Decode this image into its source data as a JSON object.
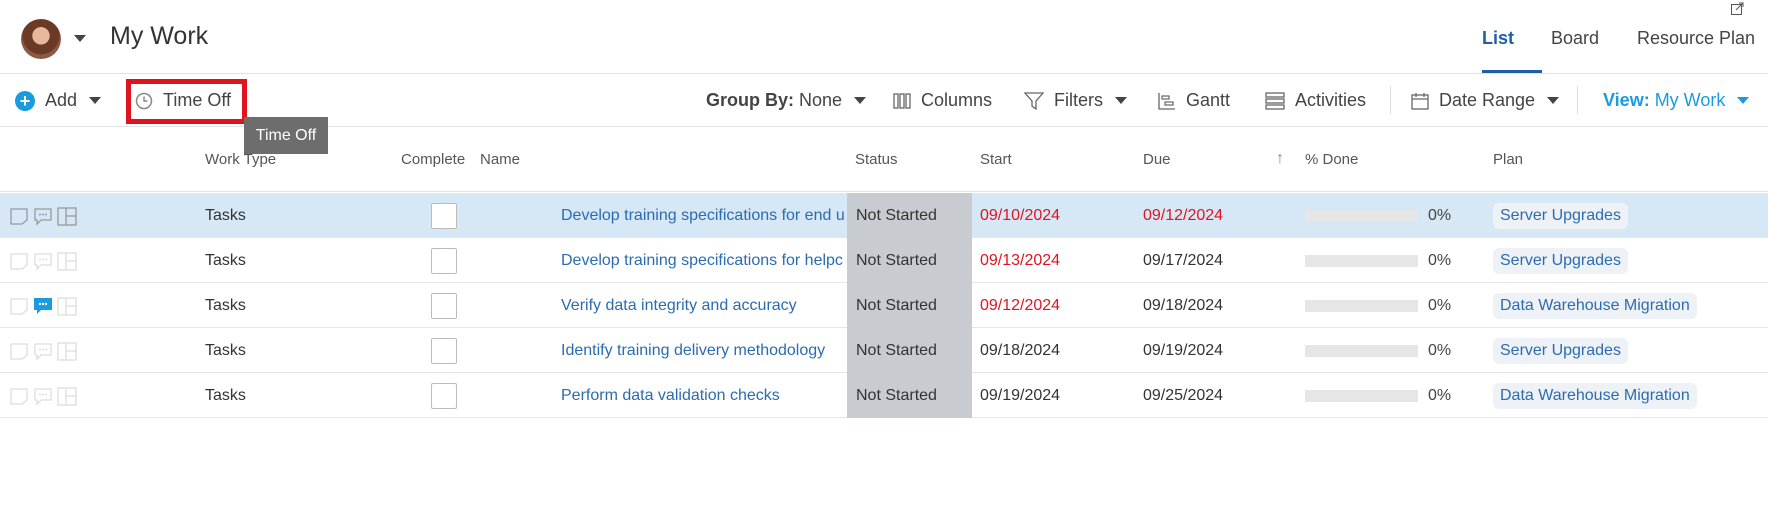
{
  "header": {
    "title": "My Work",
    "tabs": [
      {
        "label": "List",
        "active": true
      },
      {
        "label": "Board",
        "active": false
      },
      {
        "label": "Resource Plan",
        "active": false
      }
    ]
  },
  "toolbar": {
    "add_label": "Add",
    "time_off_label": "Time Off",
    "group_by_label": "Group By:",
    "group_by_value": "None",
    "columns_label": "Columns",
    "filters_label": "Filters",
    "gantt_label": "Gantt",
    "activities_label": "Activities",
    "date_range_label": "Date Range",
    "view_label": "View:",
    "view_value": "My Work"
  },
  "tooltip": {
    "text": "Time Off"
  },
  "table": {
    "columns": {
      "work_type": "Work Type",
      "complete": "Complete",
      "name": "Name",
      "status": "Status",
      "start": "Start",
      "due": "Due",
      "percent_done": "% Done",
      "plan": "Plan"
    },
    "rows": [
      {
        "work_type": "Tasks",
        "name": "Develop training specifications for end u",
        "status": "Not Started",
        "start": "09/10/2024",
        "due": "09/12/2024",
        "percent": "0%",
        "plan": "Server Upgrades"
      },
      {
        "work_type": "Tasks",
        "name": "Develop training specifications for helpc",
        "status": "Not Started",
        "start": "09/13/2024",
        "due": "09/17/2024",
        "percent": "0%",
        "plan": "Server Upgrades"
      },
      {
        "work_type": "Tasks",
        "name": "Verify data integrity and accuracy",
        "status": "Not Started",
        "start": "09/12/2024",
        "due": "09/18/2024",
        "percent": "0%",
        "plan": "Data Warehouse Migration"
      },
      {
        "work_type": "Tasks",
        "name": "Identify training delivery methodology",
        "status": "Not Started",
        "start": "09/18/2024",
        "due": "09/19/2024",
        "percent": "0%",
        "plan": "Server Upgrades"
      },
      {
        "work_type": "Tasks",
        "name": "Perform data validation checks",
        "status": "Not Started",
        "start": "09/19/2024",
        "due": "09/25/2024",
        "percent": "0%",
        "plan": "Data Warehouse Migration"
      }
    ]
  },
  "colors": {
    "accent_blue": "#1a9be0",
    "link_blue": "#2b6cb0",
    "overdue_red": "#e0141e",
    "highlight_red": "#e0141e",
    "selected_row": "#d6e7f5",
    "status_gray": "#c8cbd0"
  }
}
